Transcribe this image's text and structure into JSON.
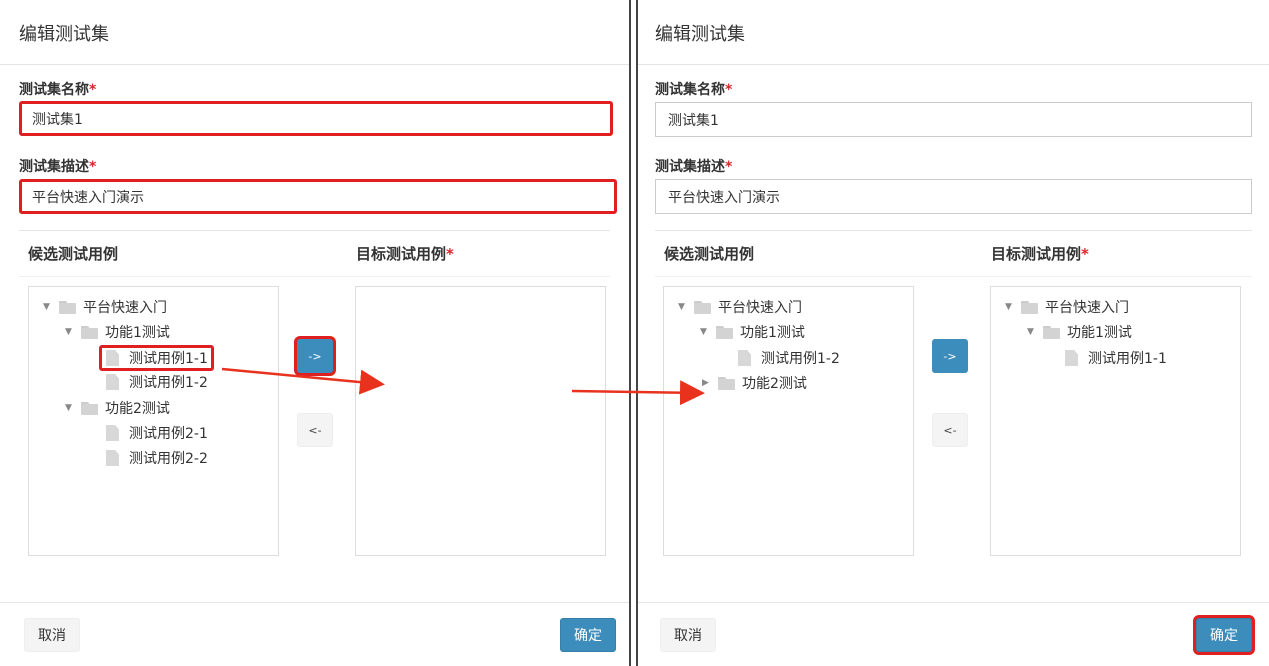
{
  "left_panel": {
    "title": "编辑测试集",
    "name_label": "测试集名称",
    "name_value": "测试集1",
    "desc_label": "测试集描述",
    "desc_value": "平台快速入门演示",
    "required_mark": "*",
    "candidate_header": "候选测试用例",
    "target_header": "目标测试用例",
    "candidate_tree": {
      "root": "平台快速入门",
      "group1": "功能1测试",
      "case1_1": "测试用例1-1",
      "case1_2": "测试用例1-2",
      "group2": "功能2测试",
      "case2_1": "测试用例2-1",
      "case2_2": "测试用例2-2"
    },
    "move_right_label": "->",
    "move_left_label": "<-",
    "cancel_label": "取消",
    "confirm_label": "确定"
  },
  "right_panel": {
    "title": "编辑测试集",
    "name_label": "测试集名称",
    "name_value": "测试集1",
    "desc_label": "测试集描述",
    "desc_value": "平台快速入门演示",
    "required_mark": "*",
    "candidate_header": "候选测试用例",
    "target_header": "目标测试用例",
    "candidate_tree": {
      "root": "平台快速入门",
      "group1": "功能1测试",
      "case1_2": "测试用例1-2",
      "group2": "功能2测试"
    },
    "target_tree": {
      "root": "平台快速入门",
      "group1": "功能1测试",
      "case1_1": "测试用例1-1"
    },
    "move_right_label": "->",
    "move_left_label": "<-",
    "cancel_label": "取消",
    "confirm_label": "确定"
  },
  "colors": {
    "primary": "#3c8dbc",
    "highlight": "#e02020",
    "required": "#d9262b"
  }
}
